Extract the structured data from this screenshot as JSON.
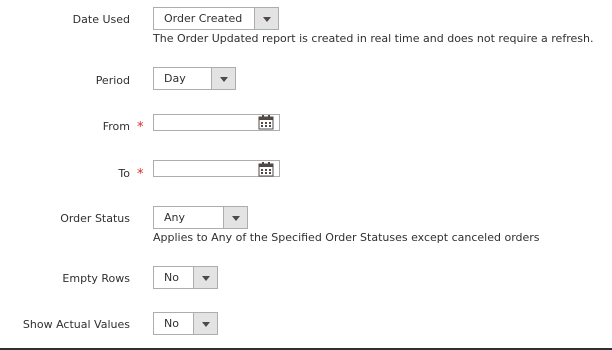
{
  "date_used": {
    "label": "Date Used",
    "value": "Order Created",
    "note": "The Order Updated report is created in real time and does not require a refresh."
  },
  "period": {
    "label": "Period",
    "value": "Day"
  },
  "from": {
    "label": "From",
    "required": "*",
    "value": ""
  },
  "to": {
    "label": "To",
    "required": "*",
    "value": ""
  },
  "order_status": {
    "label": "Order Status",
    "value": "Any",
    "note": "Applies to Any of the Specified Order Statuses except canceled orders"
  },
  "empty_rows": {
    "label": "Empty Rows",
    "value": "No"
  },
  "show_actual_values": {
    "label": "Show Actual Values",
    "value": "No"
  },
  "colors": {
    "required": "#e22626",
    "border": "#adadad",
    "arrow_bg": "#e3e3e3"
  },
  "icons": {
    "calendar": "calendar-icon",
    "dropdown": "chevron-down-icon"
  }
}
